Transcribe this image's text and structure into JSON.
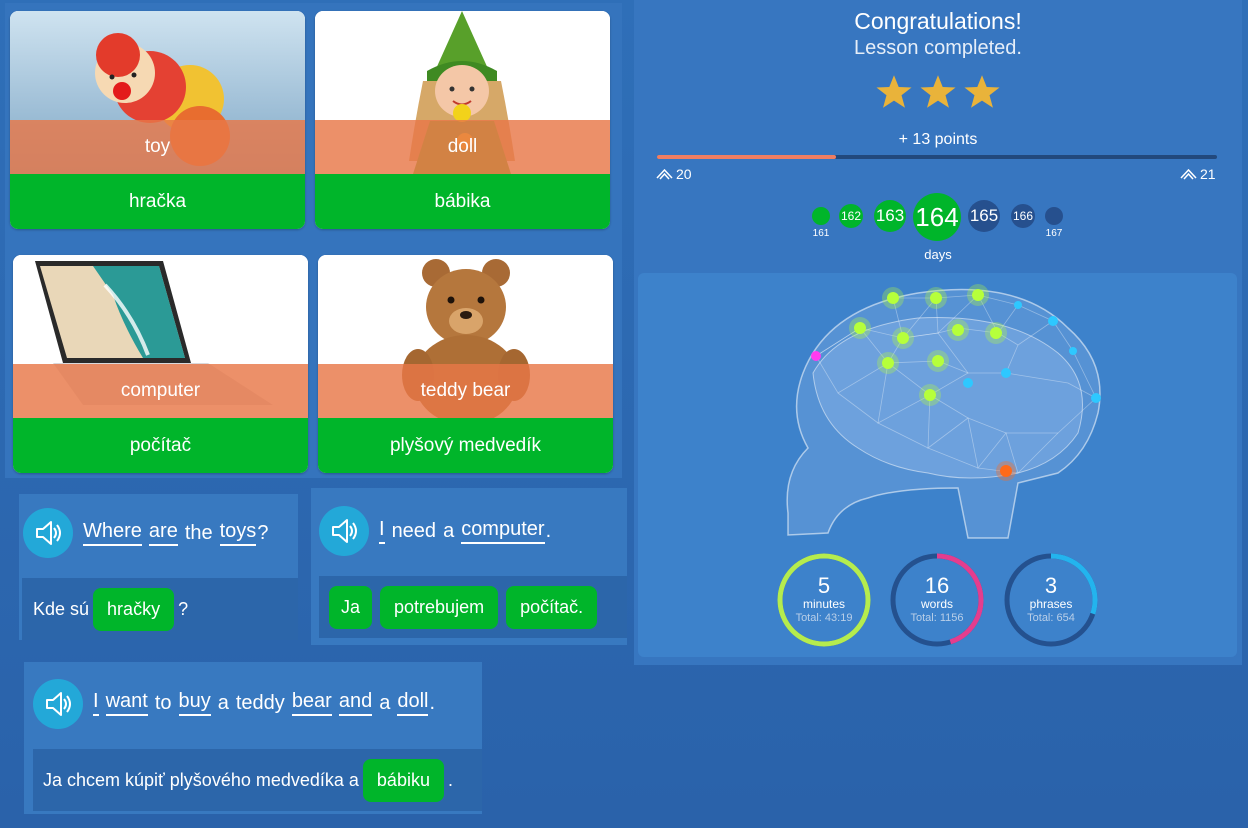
{
  "cards": [
    {
      "word": "toy",
      "translation": "hračka",
      "image": "toy-image"
    },
    {
      "word": "doll",
      "translation": "bábika",
      "image": "doll-image"
    },
    {
      "word": "computer",
      "translation": "počítač",
      "image": "laptop-image"
    },
    {
      "word": "teddy bear",
      "translation": "plyšový medvedík",
      "image": "teddy-bear-image"
    }
  ],
  "sentences": {
    "s1": {
      "words": [
        "Where",
        "are",
        "the",
        "toys",
        "?"
      ],
      "before": "Kde sú",
      "chip": "hračky",
      "after": "?"
    },
    "s2": {
      "words": [
        "I",
        "need",
        "a",
        "computer",
        "."
      ],
      "chips": [
        "Ja",
        "potrebujem",
        "počítač."
      ]
    },
    "s3": {
      "words": [
        "I",
        "want",
        "to",
        "buy",
        "a",
        "teddy",
        "bear",
        "and",
        "a",
        "doll",
        "."
      ],
      "before": "Ja chcem kúpiť plyšového medvedíka a",
      "chip": "bábiku",
      "after": "."
    }
  },
  "result": {
    "title": "Congratulations!",
    "subtitle": "Lesson completed.",
    "stars": 3,
    "points": "+ 13 points",
    "progress_fraction": 0.32,
    "level_current": "20",
    "level_next": "21",
    "days": {
      "d161": "161",
      "d162": "162",
      "d163": "163",
      "d164": "164",
      "d165": "165",
      "d166": "166",
      "d167": "167"
    },
    "days_label": "days",
    "stats": {
      "minutes": {
        "value": "5",
        "unit": "minutes",
        "total": "Total: 43:19",
        "fraction": 1.0,
        "color": "#b5ec4e"
      },
      "words": {
        "value": "16",
        "unit": "words",
        "total": "Total: 1156",
        "fraction": 0.45,
        "color": "#e43d8e"
      },
      "phrases": {
        "value": "3",
        "unit": "phrases",
        "total": "Total: 654",
        "fraction": 0.3,
        "color": "#23b4ee"
      }
    }
  },
  "icons": {
    "speaker": "speaker-icon",
    "star": "star-icon",
    "level": "chevron-up-icon",
    "brain": "brain-illustration"
  },
  "colors": {
    "background": "#2f6fb8",
    "green": "#00b52a",
    "orange_band": "#e87848",
    "speaker": "#23a8d8",
    "progress": "#ef7e62",
    "star": "#e9b33a"
  }
}
